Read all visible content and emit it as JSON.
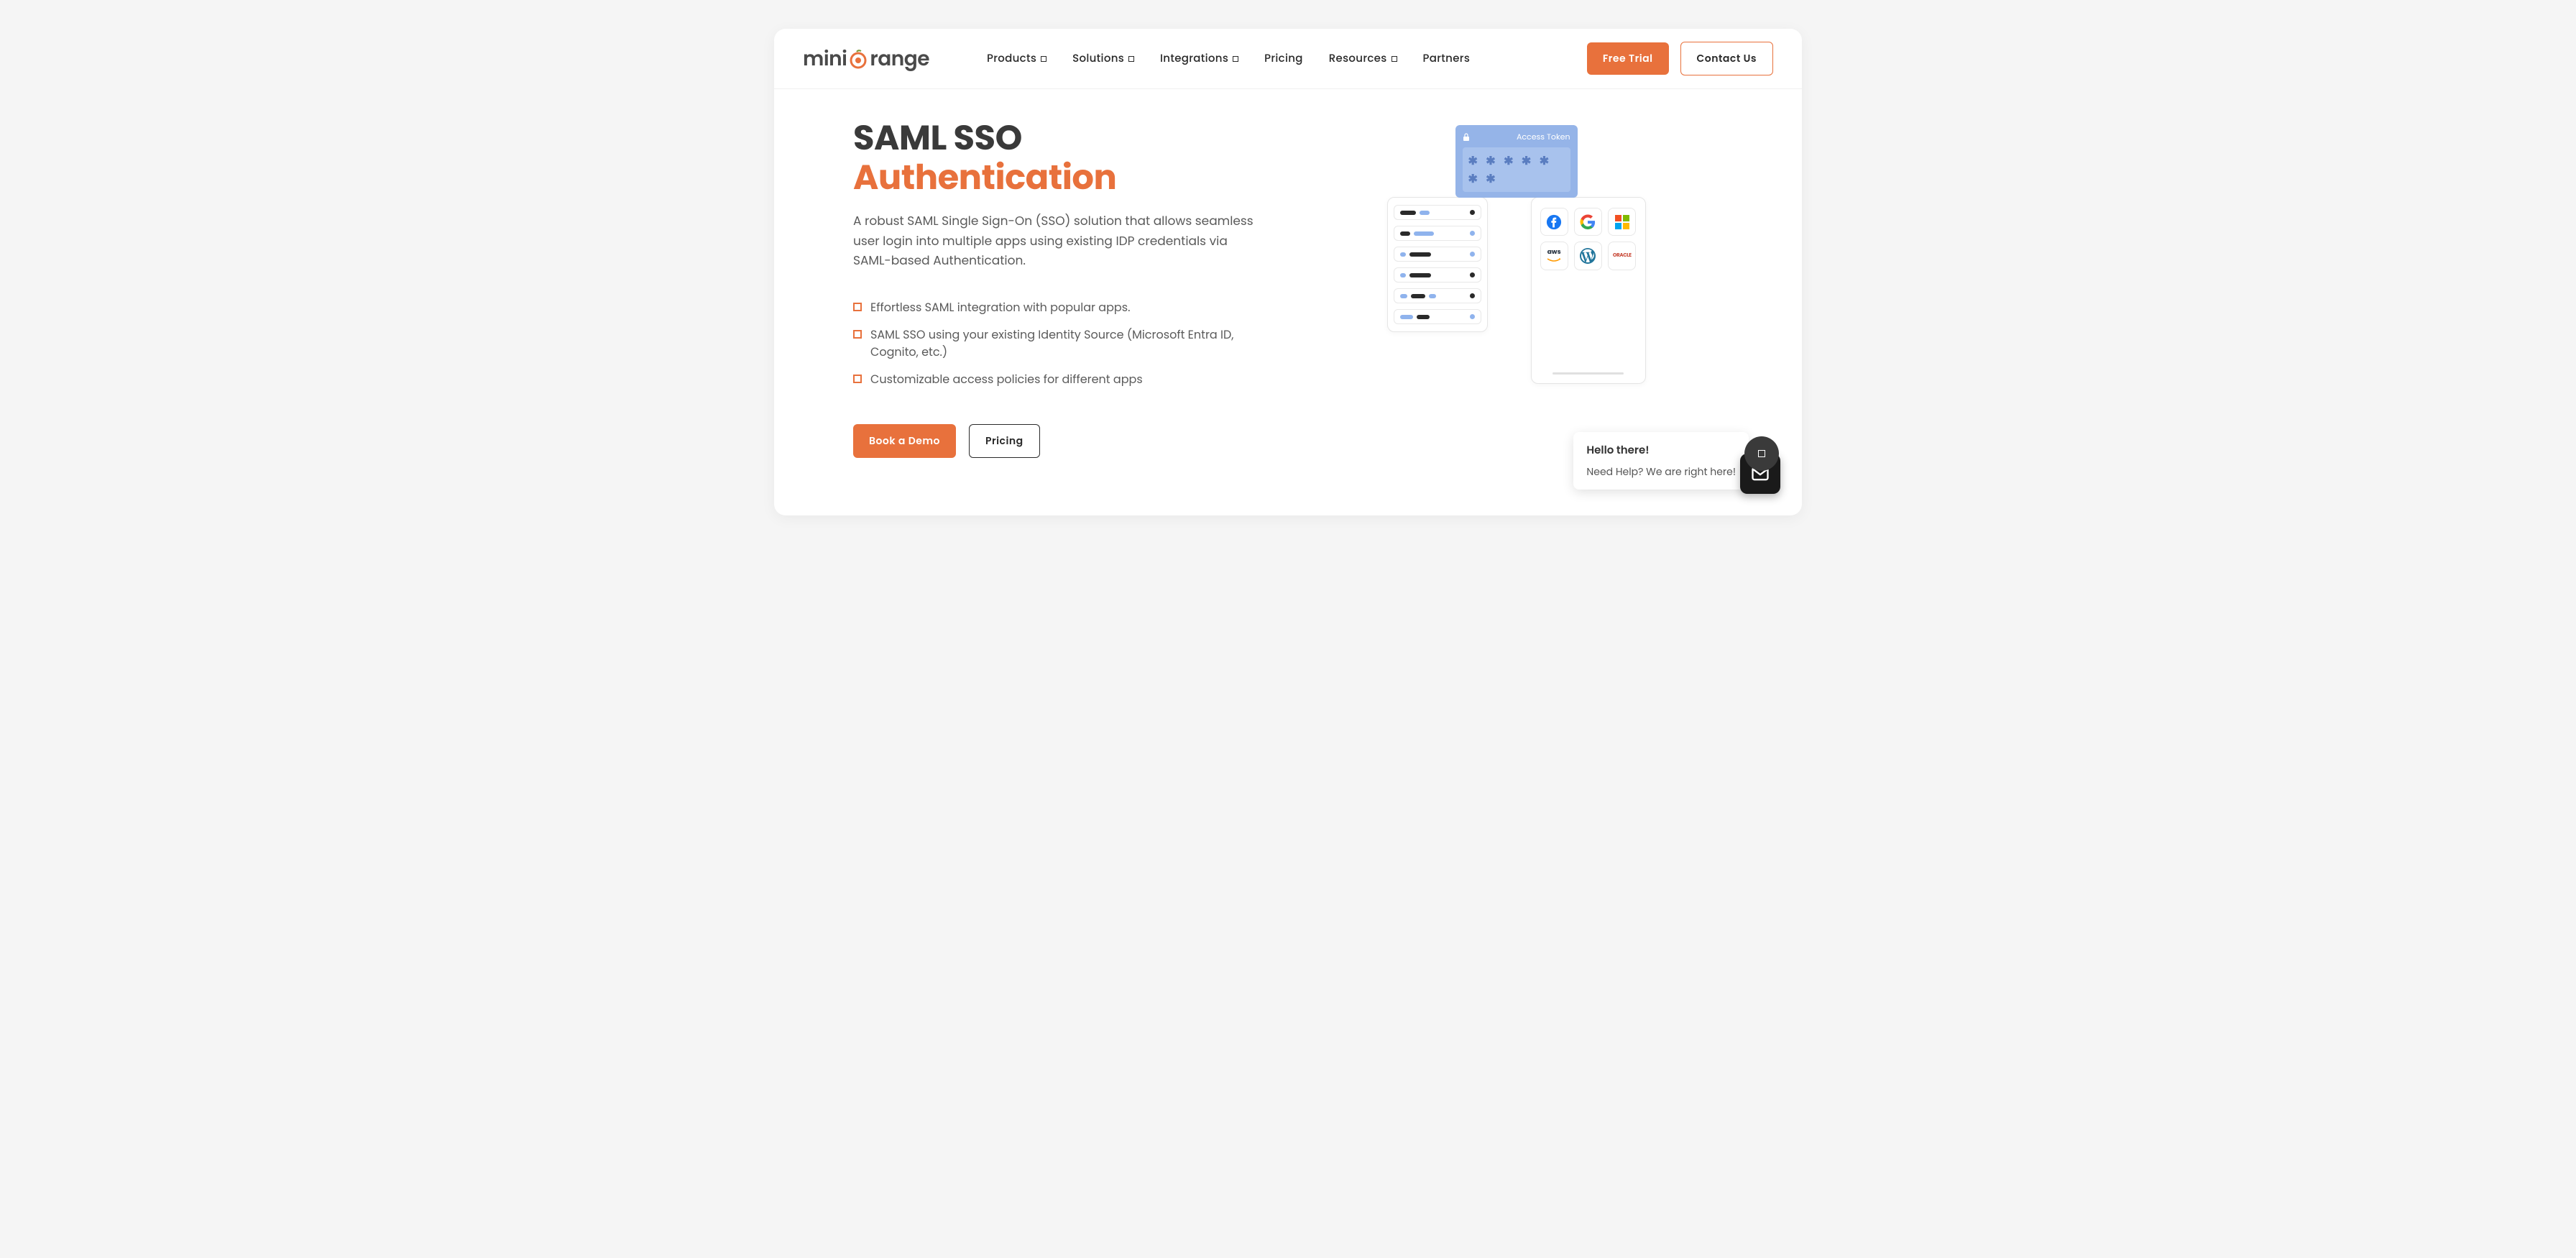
{
  "brand": {
    "name_prefix": "mini",
    "name_suffix": "range"
  },
  "nav": {
    "items": [
      {
        "label": "Products",
        "has_dropdown": true
      },
      {
        "label": "Solutions",
        "has_dropdown": true
      },
      {
        "label": "Integrations",
        "has_dropdown": true
      },
      {
        "label": "Pricing",
        "has_dropdown": false
      },
      {
        "label": "Resources",
        "has_dropdown": true
      },
      {
        "label": "Partners",
        "has_dropdown": false
      }
    ],
    "free_trial": "Free Trial",
    "contact_us": "Contact Us"
  },
  "hero": {
    "title_line1": "SAML SSO",
    "title_line2": "Authentication",
    "subtitle": "A robust SAML Single Sign-On (SSO) solution that allows seamless user login into multiple apps using existing IDP credentials via SAML-based Authentication.",
    "features": [
      "Effortless SAML integration with popular apps.",
      "SAML SSO using your existing Identity Source (Microsoft Entra ID, Cognito, etc.)",
      "Customizable access policies for different apps"
    ],
    "book_demo": "Book a Demo",
    "pricing": "Pricing"
  },
  "illustration": {
    "token_label": "Access Token",
    "token_value": "✱ ✱ ✱ ✱ ✱ ✱ ✱",
    "apps": [
      "facebook",
      "google",
      "microsoft",
      "aws",
      "wordpress",
      "oracle"
    ]
  },
  "chat": {
    "greeting": "Hello there!",
    "help": "Need Help? We are right here!"
  },
  "colors": {
    "accent": "#e8713c"
  }
}
